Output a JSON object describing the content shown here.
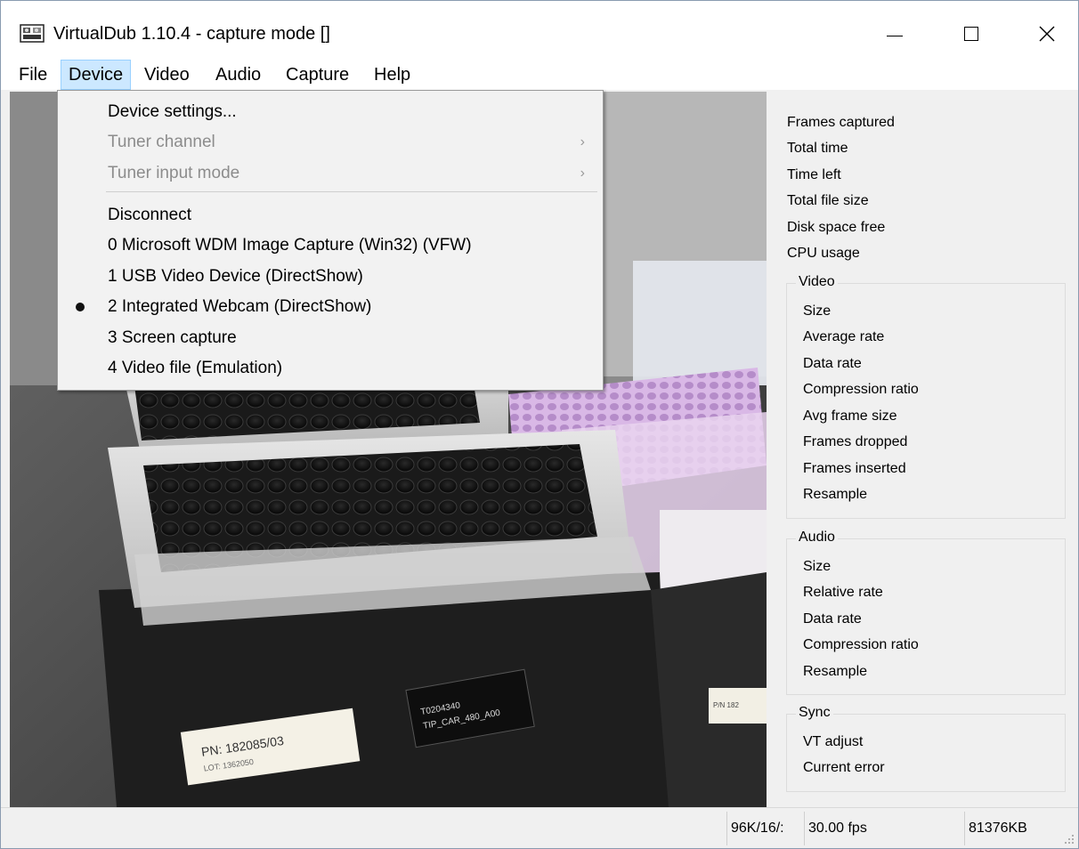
{
  "window": {
    "title": "VirtualDub 1.10.4 - capture mode []",
    "close_glyph": "✕"
  },
  "menubar": {
    "items": [
      {
        "label": "File"
      },
      {
        "label": "Device"
      },
      {
        "label": "Video"
      },
      {
        "label": "Audio"
      },
      {
        "label": "Capture"
      },
      {
        "label": "Help"
      }
    ]
  },
  "device_menu": {
    "items": [
      {
        "label": "Device settings...",
        "enabled": true
      },
      {
        "label": "Tuner channel",
        "enabled": false,
        "submenu_arrow": "›"
      },
      {
        "label": "Tuner input mode",
        "enabled": false,
        "submenu_arrow": "›"
      },
      {
        "label": "Disconnect",
        "enabled": true
      },
      {
        "label": "0 Microsoft WDM Image Capture (Win32) (VFW)",
        "enabled": true
      },
      {
        "label": "1 USB Video Device (DirectShow)",
        "enabled": true
      },
      {
        "label": "2 Integrated Webcam (DirectShow)",
        "enabled": true,
        "selected": true
      },
      {
        "label": "3 Screen capture",
        "enabled": true
      },
      {
        "label": "4 Video file (Emulation)",
        "enabled": true
      }
    ]
  },
  "preview": {
    "label_large": "PN: 182085/03",
    "label_large_sub": "LOT: 1362050",
    "label_dark_line1": "T0204340",
    "label_dark_line2": "TIP_CAR_480_A00",
    "label_side": "P/N 182"
  },
  "stats_panel": {
    "top": [
      "Frames captured",
      "Total time",
      "Time left",
      "Total file size",
      "Disk space free",
      "CPU usage"
    ],
    "video": {
      "title": "Video",
      "items": [
        "Size",
        "Average rate",
        "Data rate",
        "Compression ratio",
        "Avg frame size",
        "Frames dropped",
        "Frames inserted",
        "Resample"
      ]
    },
    "audio": {
      "title": "Audio",
      "items": [
        "Size",
        "Relative rate",
        "Data rate",
        "Compression ratio",
        "Resample"
      ]
    },
    "sync": {
      "title": "Sync",
      "items": [
        "VT adjust",
        "Current error"
      ]
    }
  },
  "statusbar": {
    "audio_format": "96K/16/:",
    "frame_rate": "30.00 fps",
    "memory": "81376KB"
  },
  "colors": {
    "menu_highlight": "#cce8ff",
    "panel_bg": "#f0f0f0",
    "disabled_text": "#8c8c8c"
  }
}
